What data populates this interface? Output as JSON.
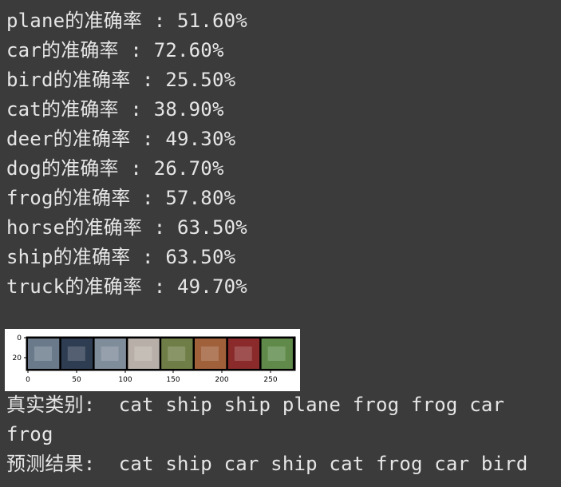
{
  "accuracy_lines": [
    "plane的准确率 : 51.60%",
    "car的准确率 : 72.60%",
    "bird的准确率 : 25.50%",
    "cat的准确率 : 38.90%",
    "deer的准确率 : 49.30%",
    "dog的准确率 : 26.70%",
    "frog的准确率 : 57.80%",
    "horse的准确率 : 63.50%",
    "ship的准确率 : 63.50%",
    "truck的准确率 : 49.70%"
  ],
  "figure": {
    "y_ticks": [
      "0",
      "20"
    ],
    "x_ticks": [
      "0",
      "50",
      "100",
      "150",
      "200",
      "250"
    ],
    "thumb_colors": [
      "#6b7a8a",
      "#2f3d52",
      "#7f8c9a",
      "#b8b0a8",
      "#6f7e46",
      "#a0603a",
      "#8a2a2a",
      "#5f8a4a"
    ]
  },
  "ground_truth_line1": "真实类别:  cat ship ship plane frog frog car",
  "ground_truth_line2": "frog",
  "prediction_line": "预测结果:  cat ship car ship cat frog car bird"
}
